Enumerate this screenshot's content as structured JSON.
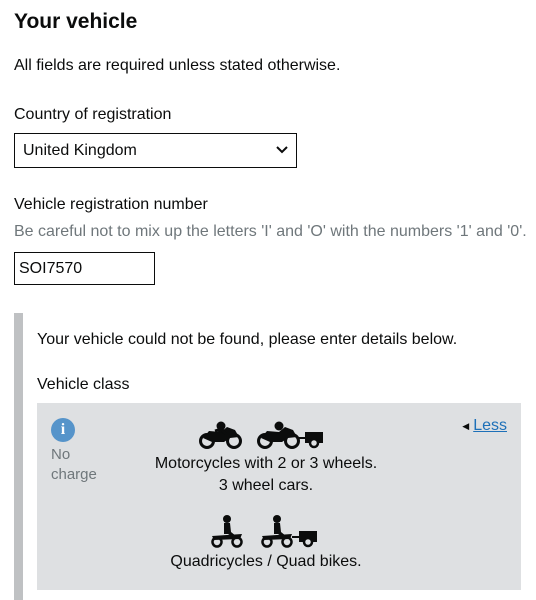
{
  "page": {
    "title": "Your vehicle",
    "intro": "All fields are required unless stated otherwise."
  },
  "country": {
    "label": "Country of registration",
    "selected": "United Kingdom"
  },
  "registration": {
    "label": "Vehicle registration number",
    "hint": "Be careful not to mix up the letters 'I' and 'O' with the numbers '1' and '0'.",
    "value": "SOI7570"
  },
  "panel": {
    "notice": "Your vehicle could not be found, please enter details below.",
    "class_label": "Vehicle class",
    "classes": [
      {
        "charge": "No charge",
        "toggle": "Less",
        "groups": [
          {
            "icons": [
              "motorcycle-icon",
              "motorcycle-trailer-icon"
            ],
            "lines": [
              "Motorcycles with 2 or 3 wheels.",
              "3 wheel cars."
            ]
          },
          {
            "icons": [
              "quad-bike-icon",
              "quad-bike-trailer-icon"
            ],
            "lines": [
              "Quadricycles / Quad bikes."
            ]
          }
        ]
      }
    ]
  },
  "colors": {
    "text": "#0b0c0c",
    "hint": "#6f777b",
    "link": "#1d70b8",
    "info": "#5694ca",
    "panel_bar": "#bfc1c3",
    "class_bg": "#dee0e2"
  }
}
